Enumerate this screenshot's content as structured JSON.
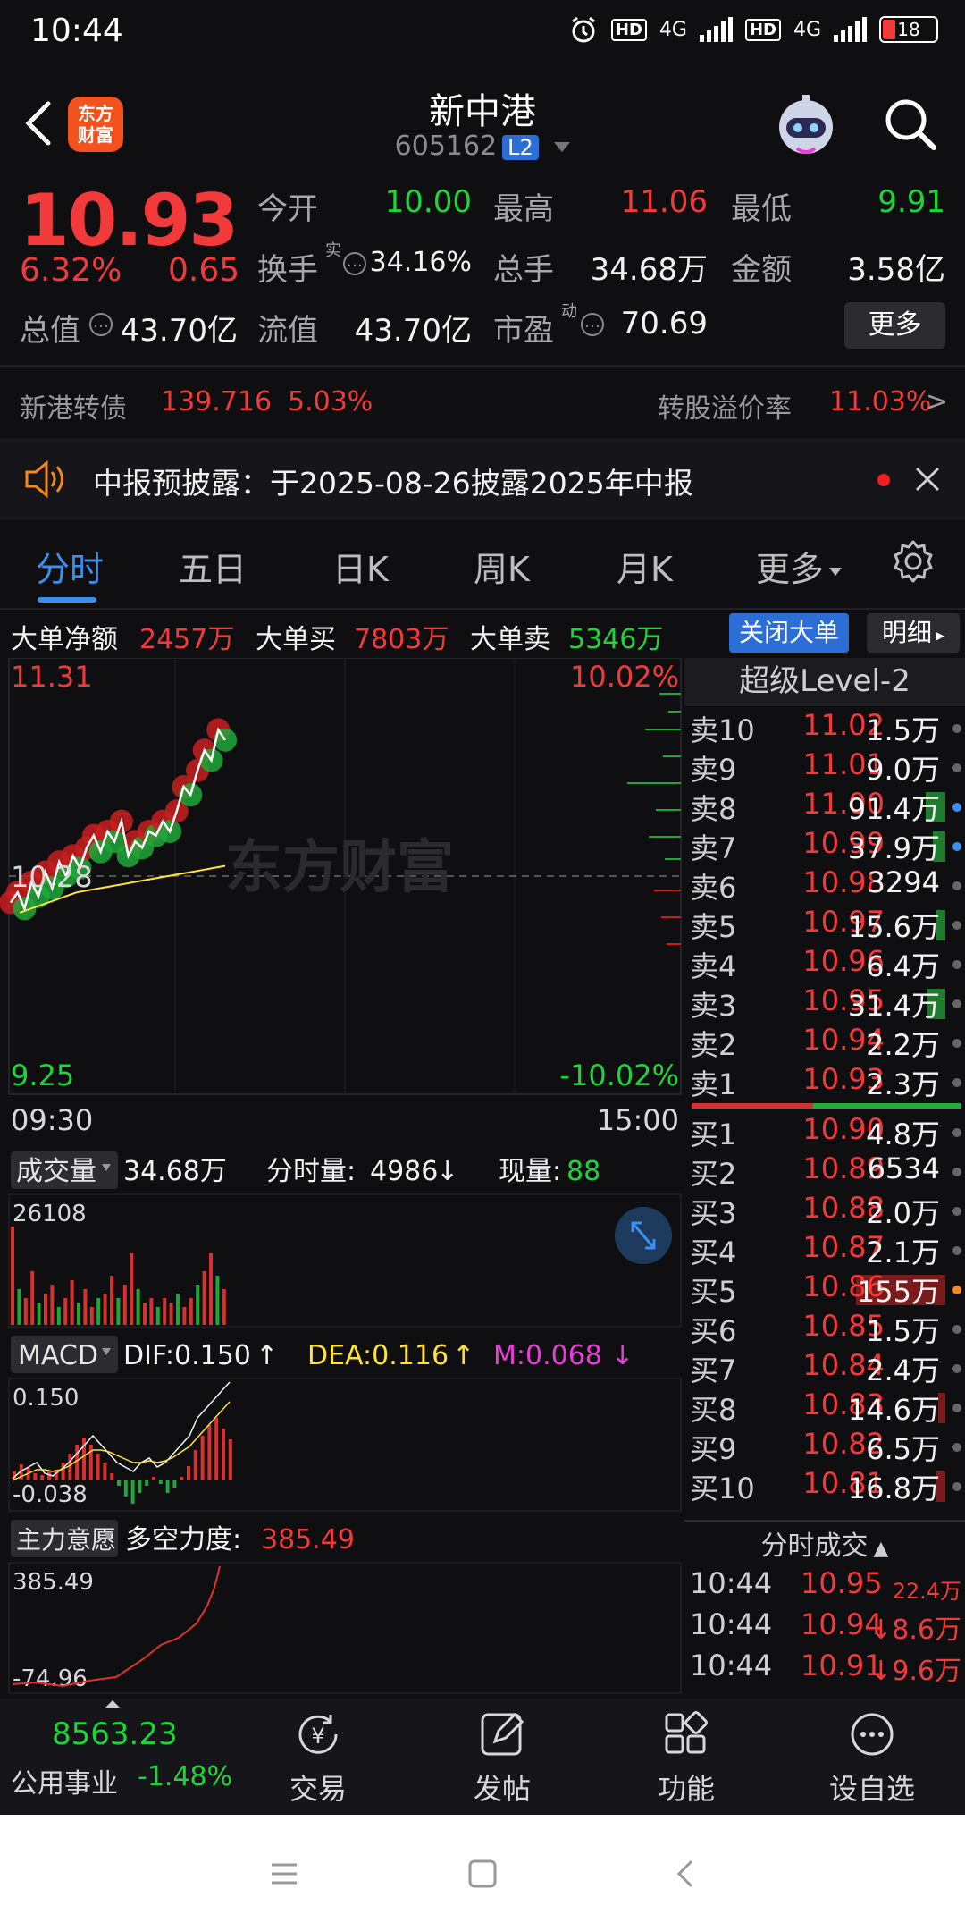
{
  "status_bar": {
    "time": "10:44",
    "battery": "18",
    "hd1": "HD",
    "hd2": "HD",
    "net1": "4G",
    "net2": "4G"
  },
  "header": {
    "title": "新中港",
    "code": "605162",
    "badge": "L2",
    "logo_line1": "东方",
    "logo_line2": "财富"
  },
  "quote": {
    "price": "10.93",
    "pct": "6.32%",
    "change": "0.65",
    "open_label": "今开",
    "open": "10.00",
    "high_label": "最高",
    "high": "11.06",
    "low_label": "最低",
    "low": "9.91",
    "turnover_label": "换手",
    "turnover_sup": "实",
    "turnover": "34.16%",
    "volume_label": "总手",
    "volume": "34.68万",
    "amount_label": "金额",
    "amount": "3.58亿",
    "mktcap_label": "总值",
    "mktcap": "43.70亿",
    "float_label": "流值",
    "float": "43.70亿",
    "pe_label": "市盈",
    "pe_sup": "动",
    "pe": "70.69",
    "more_label": "更多"
  },
  "bond": {
    "name": "新港转债",
    "price": "139.716",
    "pct": "5.03%",
    "premium_label": "转股溢价率",
    "premium": "11.03%",
    "arrow": ">"
  },
  "notice": {
    "text": "中报预披露：于2025-08-26披露2025年中报"
  },
  "tabs": [
    "分时",
    "五日",
    "日K",
    "周K",
    "月K",
    "更多"
  ],
  "big_order": {
    "net_label": "大单净额",
    "net": "2457万",
    "buy_label": "大单买",
    "buy": "7803万",
    "sell_label": "大单卖",
    "sell": "5346万",
    "close_label": "关闭大单",
    "detail_label": "明细"
  },
  "chart": {
    "top_price": "11.31",
    "mid_price": "10.28",
    "bottom_price": "9.25",
    "top_pct": "10.02%",
    "bottom_pct": "-10.02%",
    "start_time": "09:30",
    "end_time": "15:00",
    "watermark": "东方财富"
  },
  "volume_panel": {
    "label": "成交量",
    "total": "34.68万",
    "minute_label": "分时量:",
    "minute": "4986",
    "current_label": "现量:",
    "current": "88",
    "max": "26108"
  },
  "macd_panel": {
    "label": "MACD",
    "dif": "DIF:0.150",
    "dea": "DEA:0.116",
    "m": "M:0.068",
    "top": "0.150",
    "bottom": "-0.038"
  },
  "main_panel": {
    "label": "主力意愿",
    "power_label": "多空力度:",
    "power": "385.49",
    "top": "385.49",
    "bottom": "-74.96"
  },
  "chart_data": {
    "type": "line",
    "title": "",
    "x": [
      "09:30",
      "15:00"
    ],
    "ylim": [
      9.25,
      11.31
    ],
    "prev_close": 10.28,
    "series": [
      {
        "values": [
          10.15,
          10.2,
          10.12,
          10.25,
          10.18,
          10.3,
          10.22,
          10.35,
          10.28,
          10.38,
          10.32,
          10.42,
          10.48,
          10.4,
          10.5,
          10.45,
          10.55,
          10.38,
          10.45,
          10.42,
          10.5,
          10.48,
          10.55,
          10.5,
          10.6,
          10.72,
          10.68,
          10.8,
          10.9,
          10.85,
          11.0,
          10.95
        ]
      },
      {
        "values": [
          10.1,
          10.12,
          10.14,
          10.16,
          10.18,
          10.2,
          10.21,
          10.22,
          10.23,
          10.24,
          10.25,
          10.26,
          10.27,
          10.28,
          10.29,
          10.3,
          10.31,
          10.32,
          10.33
        ]
      }
    ]
  },
  "orderbook": {
    "header": "超级Level-2",
    "asks": [
      {
        "label": "卖10",
        "price": "11.02",
        "vol": "1.5万"
      },
      {
        "label": "卖9",
        "price": "11.01",
        "vol": "9.0万"
      },
      {
        "label": "卖8",
        "price": "11.00",
        "vol": "91.4万"
      },
      {
        "label": "卖7",
        "price": "10.99",
        "vol": "37.9万"
      },
      {
        "label": "卖6",
        "price": "10.98",
        "vol": "3294"
      },
      {
        "label": "卖5",
        "price": "10.97",
        "vol": "15.6万"
      },
      {
        "label": "卖4",
        "price": "10.96",
        "vol": "6.4万"
      },
      {
        "label": "卖3",
        "price": "10.95",
        "vol": "31.4万"
      },
      {
        "label": "卖2",
        "price": "10.94",
        "vol": "2.2万"
      },
      {
        "label": "卖1",
        "price": "10.93",
        "vol": "2.3万"
      }
    ],
    "bids": [
      {
        "label": "买1",
        "price": "10.90",
        "vol": "4.8万"
      },
      {
        "label": "买2",
        "price": "10.89",
        "vol": "6534"
      },
      {
        "label": "买3",
        "price": "10.88",
        "vol": "2.0万"
      },
      {
        "label": "买4",
        "price": "10.87",
        "vol": "2.1万"
      },
      {
        "label": "买5",
        "price": "10.86",
        "vol": "155万"
      },
      {
        "label": "买6",
        "price": "10.85",
        "vol": "1.5万"
      },
      {
        "label": "买7",
        "price": "10.84",
        "vol": "2.4万"
      },
      {
        "label": "买8",
        "price": "10.83",
        "vol": "14.6万"
      },
      {
        "label": "买9",
        "price": "10.82",
        "vol": "6.5万"
      },
      {
        "label": "买10",
        "price": "10.81",
        "vol": "16.8万"
      }
    ],
    "trades_header": "分时成交",
    "trades": [
      {
        "time": "10:44",
        "price": "10.95",
        "vol": "22.4万"
      },
      {
        "time": "10:44",
        "price": "10.94",
        "vol": "↓8.6万"
      },
      {
        "time": "10:44",
        "price": "10.91",
        "vol": "↓9.6万"
      }
    ]
  },
  "bottom_nav": {
    "index_value": "8563.23",
    "index_name": "公用事业",
    "index_pct": "-1.48%",
    "items": [
      "交易",
      "发帖",
      "功能",
      "设自选"
    ]
  }
}
